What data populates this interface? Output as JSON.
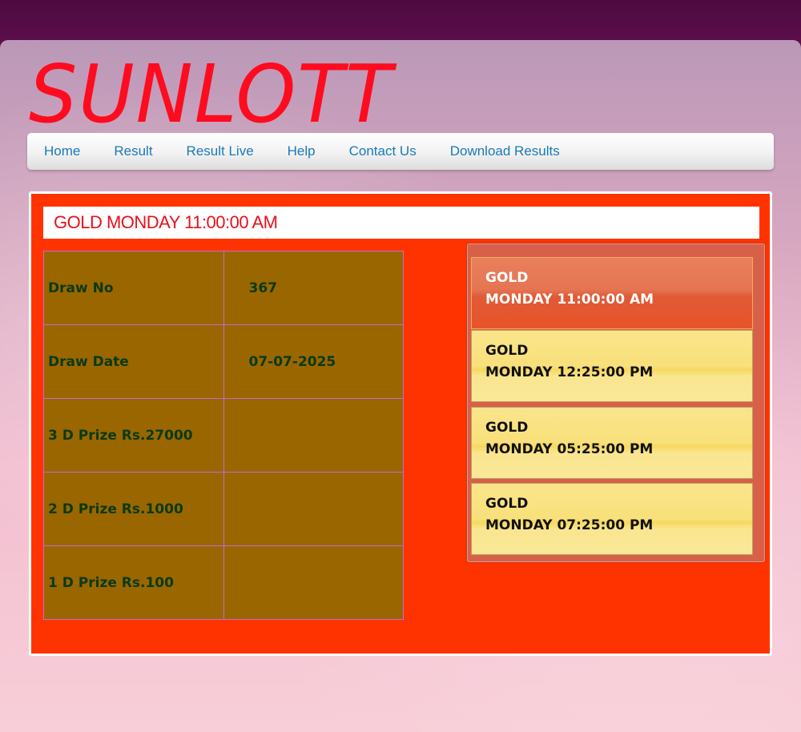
{
  "logo": "SUNLOTT",
  "nav": {
    "items": [
      "Home",
      "Result",
      "Result Live",
      "Help",
      "Contact Us",
      "Download Results"
    ]
  },
  "title": "GOLD MONDAY 11:00:00 AM",
  "results": [
    {
      "label": "Draw No",
      "value": "367"
    },
    {
      "label": "Draw Date",
      "value": "07-07-2025"
    },
    {
      "label": "3 D Prize Rs.27000",
      "value": ""
    },
    {
      "label": "2 D Prize Rs.1000",
      "value": ""
    },
    {
      "label": "1 D Prize Rs.100",
      "value": ""
    }
  ],
  "draws": [
    {
      "name": "GOLD",
      "time": "MONDAY 11:00:00 AM",
      "active": true
    },
    {
      "name": "GOLD",
      "time": "MONDAY 12:25:00 PM",
      "active": false
    },
    {
      "name": "GOLD",
      "time": "MONDAY 05:25:00 PM",
      "active": false
    },
    {
      "name": "GOLD",
      "time": "MONDAY 07:25:00 PM",
      "active": false
    }
  ],
  "colors": {
    "logo": "#ff0b1f",
    "nav_link": "#1a7ab8",
    "main_bg": "#ff3300",
    "table_bg": "#996600",
    "table_text": "#0b3a14",
    "draw_item": "#fae58c",
    "draw_item_active": "#e57552"
  }
}
